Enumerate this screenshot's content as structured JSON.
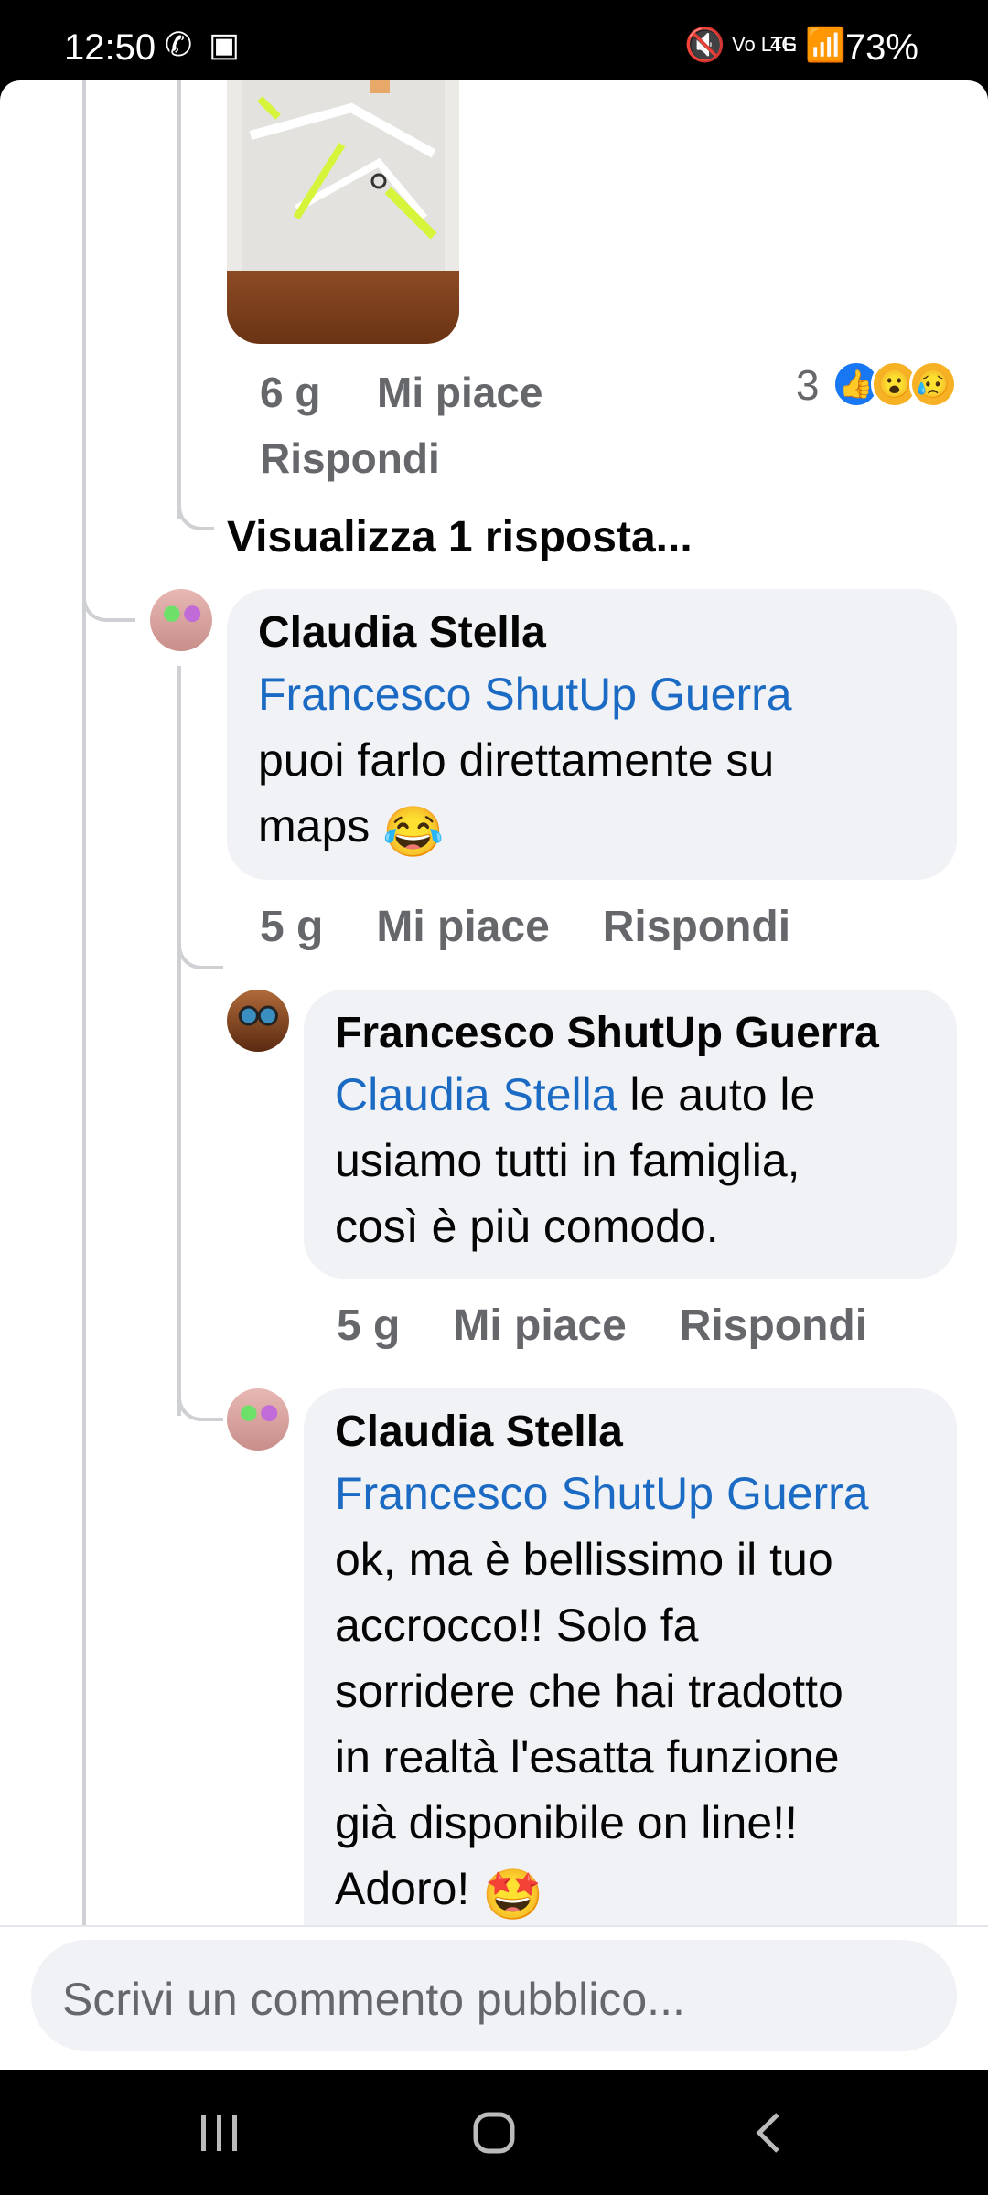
{
  "status_bar": {
    "time": "12:50",
    "battery": "73%"
  },
  "comment_top": {
    "age": "6 g",
    "like": "Mi piace",
    "reply": "Rispondi",
    "reaction_count": "3"
  },
  "view_replies": "Visualizza 1 risposta...",
  "comments": [
    {
      "name": "Claudia Stella",
      "mention": "Francesco ShutUp Guerra",
      "line1": "puoi farlo direttamente su",
      "line2": "maps",
      "emoji": "😂",
      "age": "5 g",
      "like": "Mi piace",
      "reply": "Rispondi"
    },
    {
      "name": "Francesco ShutUp Guerra",
      "mention": "Claudia Stella",
      "line1": " le auto le",
      "line2": "usiamo tutti in famiglia,",
      "line3": "così è più comodo.",
      "age": "5 g",
      "like": "Mi piace",
      "reply": "Rispondi"
    },
    {
      "name": "Claudia Stella",
      "mention": "Francesco ShutUp Guerra",
      "line1": "ok, ma è bellissimo il tuo",
      "line2": "accrocco!! Solo fa",
      "line3": "sorridere che hai tradotto",
      "line4": "in realtà l'esatta funzione",
      "line5": "già disponibile on line!!",
      "line6": "Adoro!",
      "emoji": "🤩"
    }
  ],
  "composer": {
    "placeholder": "Scrivi un commento pubblico..."
  }
}
